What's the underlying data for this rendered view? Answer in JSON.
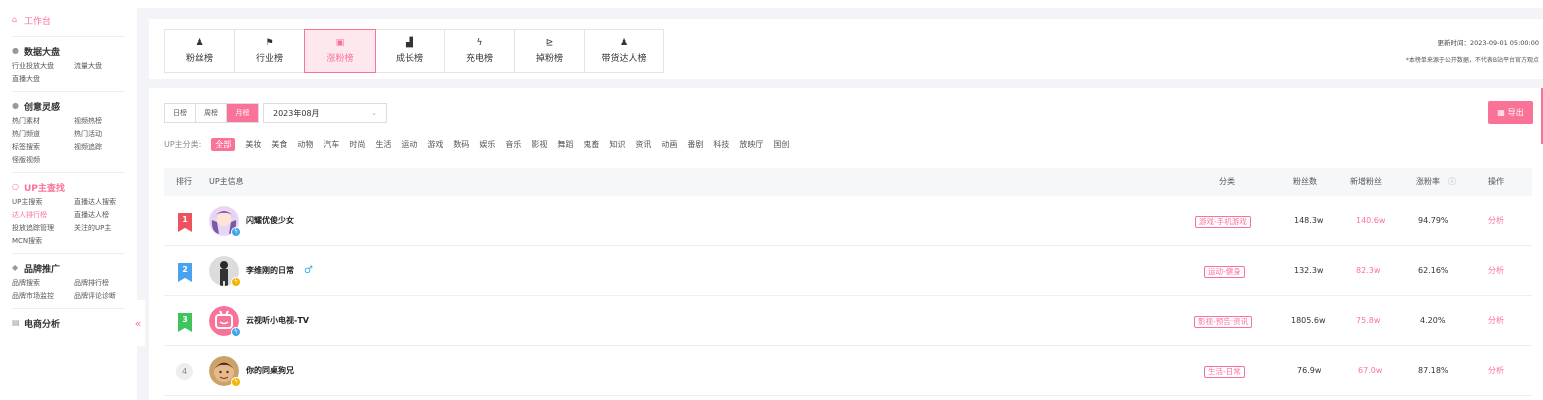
{
  "sidebar": {
    "workbench": "工作台",
    "sections": [
      {
        "title": "数据大盘",
        "items": [
          "行业投放大盘",
          "流量大盘",
          "直播大盘"
        ]
      },
      {
        "title": "创意灵感",
        "items": [
          "热门素材",
          "视频热榜",
          "热门频道",
          "热门活动",
          "标签搜索",
          "视频追踪",
          "怪版视频"
        ]
      },
      {
        "title": "UP主查找",
        "items": [
          "UP主搜索",
          "直播达人搜索",
          "达人排行榜",
          "直播达人榜",
          "投放追踪管理",
          "关注的UP主",
          "MCN搜索"
        ]
      },
      {
        "title": "品牌推广",
        "items": [
          "品牌搜索",
          "品牌排行榜",
          "品牌市场监控",
          "品牌评论诊断"
        ]
      },
      {
        "title": "电商分析",
        "items": []
      }
    ],
    "active_item": "达人排行榜",
    "collapse_glyph": "«"
  },
  "tabs": [
    {
      "label": "粉丝榜",
      "icon": "user-icon"
    },
    {
      "label": "行业榜",
      "icon": "flag-icon"
    },
    {
      "label": "涨粉榜",
      "icon": "growth-icon",
      "active": true
    },
    {
      "label": "成长榜",
      "icon": "bar-chart-icon"
    },
    {
      "label": "充电榜",
      "icon": "lightning-icon"
    },
    {
      "label": "掉粉榜",
      "icon": "decline-icon"
    },
    {
      "label": "带货达人榜",
      "icon": "seller-icon"
    }
  ],
  "update_time": "更新时间：2023-09-01 05:00:00",
  "disclaimer": "*本榜单来源于公开数据，不代表B站平台官方观点",
  "period_tabs": [
    "日榜",
    "周榜",
    "月榜"
  ],
  "active_period": "月榜",
  "month_select": "2023年08月",
  "export_label": "导出",
  "category_label": "UP主分类:",
  "categories": [
    "全部",
    "美妆",
    "美食",
    "动物",
    "汽车",
    "时尚",
    "生活",
    "运动",
    "游戏",
    "数码",
    "娱乐",
    "音乐",
    "影视",
    "舞蹈",
    "鬼畜",
    "知识",
    "资讯",
    "动画",
    "番剧",
    "科技",
    "放映厅",
    "国创"
  ],
  "table": {
    "headers": [
      "排行",
      "UP主信息",
      "分类",
      "粉丝数",
      "新增粉丝",
      "涨粉率",
      "操作"
    ],
    "rows": [
      {
        "rank": "1",
        "name": "闪耀优俊少女",
        "category": "游戏-手机游戏",
        "fans": "148.3w",
        "new_fans": "140.6w",
        "rate": "94.79%",
        "action": "分析"
      },
      {
        "rank": "2",
        "name": "李维刚的日常",
        "gender": "♂",
        "category": "运动-健身",
        "fans": "132.3w",
        "new_fans": "82.3w",
        "rate": "62.16%",
        "action": "分析"
      },
      {
        "rank": "3",
        "name": "云视听小电视-TV",
        "category": "影视-预告·资讯",
        "fans": "1805.6w",
        "new_fans": "75.8w",
        "rate": "4.20%",
        "action": "分析"
      },
      {
        "rank": "4",
        "name": "你的同桌狗兄",
        "category": "生活-日常",
        "fans": "76.9w",
        "new_fans": "67.0w",
        "rate": "87.18%",
        "action": "分析"
      }
    ]
  },
  "colors": {
    "accent": "#fb7299",
    "rank1": "#f0525d",
    "rank2": "#4aa3f0",
    "rank3": "#3ec45a"
  }
}
